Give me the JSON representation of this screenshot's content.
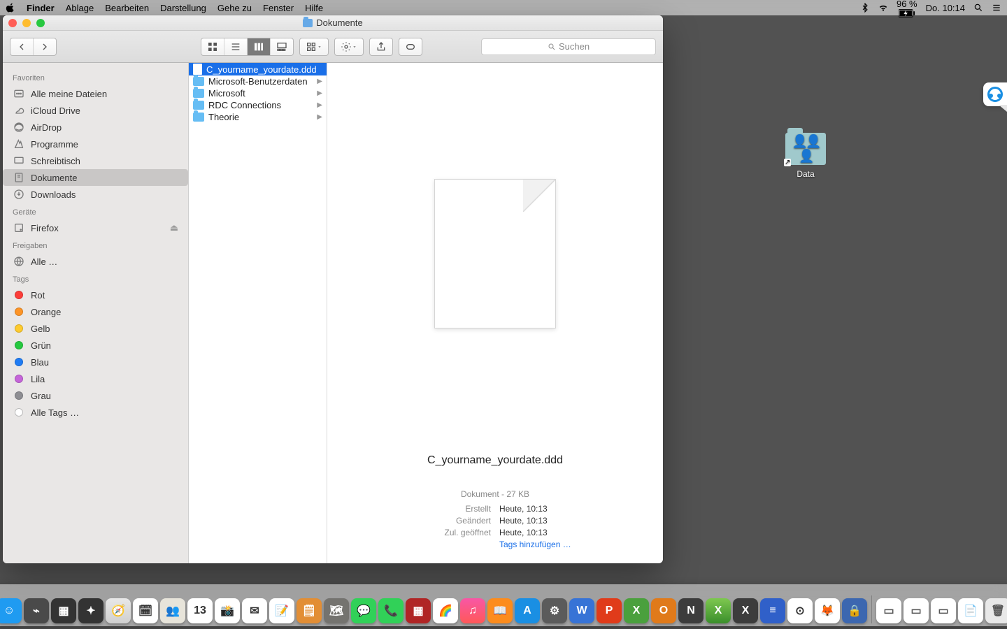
{
  "menubar": {
    "app": "Finder",
    "items": [
      "Ablage",
      "Bearbeiten",
      "Darstellung",
      "Gehe zu",
      "Fenster",
      "Hilfe"
    ],
    "battery": "96 %",
    "clock": "Do. 10:14"
  },
  "desktop": {
    "data_label": "Data"
  },
  "window": {
    "title": "Dokumente",
    "search_placeholder": "Suchen",
    "sidebar": {
      "favorites_label": "Favoriten",
      "favorites": [
        "Alle meine Dateien",
        "iCloud Drive",
        "AirDrop",
        "Programme",
        "Schreibtisch",
        "Dokumente",
        "Downloads"
      ],
      "favorites_selected": 5,
      "devices_label": "Geräte",
      "devices": [
        "Firefox"
      ],
      "shared_label": "Freigaben",
      "shared": [
        "Alle …"
      ],
      "tags_label": "Tags",
      "tags": [
        {
          "name": "Rot",
          "color": "#fc3d39"
        },
        {
          "name": "Orange",
          "color": "#fd9426"
        },
        {
          "name": "Gelb",
          "color": "#fecb2e"
        },
        {
          "name": "Grün",
          "color": "#26c940"
        },
        {
          "name": "Blau",
          "color": "#1f7cf4"
        },
        {
          "name": "Lila",
          "color": "#c565d9"
        },
        {
          "name": "Grau",
          "color": "#8e8e93"
        }
      ],
      "alltags": "Alle Tags …"
    },
    "column": {
      "items": [
        {
          "name": "C_yourname_yourdate.ddd",
          "type": "file",
          "selected": true
        },
        {
          "name": "Microsoft-Benutzerdaten",
          "type": "folder"
        },
        {
          "name": "Microsoft",
          "type": "folder"
        },
        {
          "name": "RDC Connections",
          "type": "folder"
        },
        {
          "name": "Theorie",
          "type": "folder"
        }
      ]
    },
    "preview": {
      "filename": "C_yourname_yourdate.ddd",
      "type_line": "Dokument - 27 KB",
      "created_k": "Erstellt",
      "created_v": "Heute, 10:13",
      "modified_k": "Geändert",
      "modified_v": "Heute, 10:13",
      "opened_k": "Zul. geöffnet",
      "opened_v": "Heute, 10:13",
      "addtags": "Tags hinzufügen …"
    }
  },
  "dock": [
    {
      "bg": "#1f9bf1",
      "char": "☺"
    },
    {
      "bg": "#4a4a4a",
      "char": "⌁"
    },
    {
      "bg": "#333",
      "char": "▦"
    },
    {
      "bg": "#333",
      "char": "✦"
    },
    {
      "bg": "linear-gradient(#e8e8e8,#cfcfcf)",
      "char": "🧭"
    },
    {
      "bg": "#fff",
      "char": "🗓"
    },
    {
      "bg": "#e7e4da",
      "char": "👥"
    },
    {
      "bg": "#fff",
      "char": "13"
    },
    {
      "bg": "#fff",
      "char": "📸"
    },
    {
      "bg": "#fff",
      "char": "✉"
    },
    {
      "bg": "#fff",
      "char": "📝"
    },
    {
      "bg": "#e28e35",
      "char": "🗒"
    },
    {
      "bg": "#74736f",
      "char": "🗺"
    },
    {
      "bg": "#31d158",
      "char": "💬"
    },
    {
      "bg": "#31d158",
      "char": "📞"
    },
    {
      "bg": "#b02525",
      "char": "▦"
    },
    {
      "bg": "#fff",
      "char": "🌈"
    },
    {
      "bg": "linear-gradient(#f857a6,#ff5858)",
      "char": "♫"
    },
    {
      "bg": "#fc8c1d",
      "char": "📖"
    },
    {
      "bg": "#1a8fe3",
      "char": "A"
    },
    {
      "bg": "#5b5b5b",
      "char": "⚙"
    },
    {
      "bg": "#3773d6",
      "char": "W"
    },
    {
      "bg": "#e03b1a",
      "char": "P"
    },
    {
      "bg": "#4aa03d",
      "char": "X"
    },
    {
      "bg": "#e07a1a",
      "char": "O"
    },
    {
      "bg": "#3c3c3c",
      "char": "N"
    },
    {
      "bg": "linear-gradient(#7ec850,#3a8e2b)",
      "char": "X"
    },
    {
      "bg": "#3c3c3c",
      "char": "X"
    },
    {
      "bg": "#3060c9",
      "char": "≡"
    },
    {
      "bg": "#fff",
      "char": "⊙"
    },
    {
      "bg": "#fff",
      "char": "🦊"
    },
    {
      "bg": "#3c67b0",
      "char": "🔒"
    }
  ],
  "dock_right": [
    {
      "bg": "#fff",
      "char": "▭"
    },
    {
      "bg": "#fff",
      "char": "▭"
    },
    {
      "bg": "#fff",
      "char": "▭"
    },
    {
      "bg": "#fff",
      "char": "📄"
    },
    {
      "bg": "#e8e8e8",
      "char": "🗑"
    }
  ]
}
